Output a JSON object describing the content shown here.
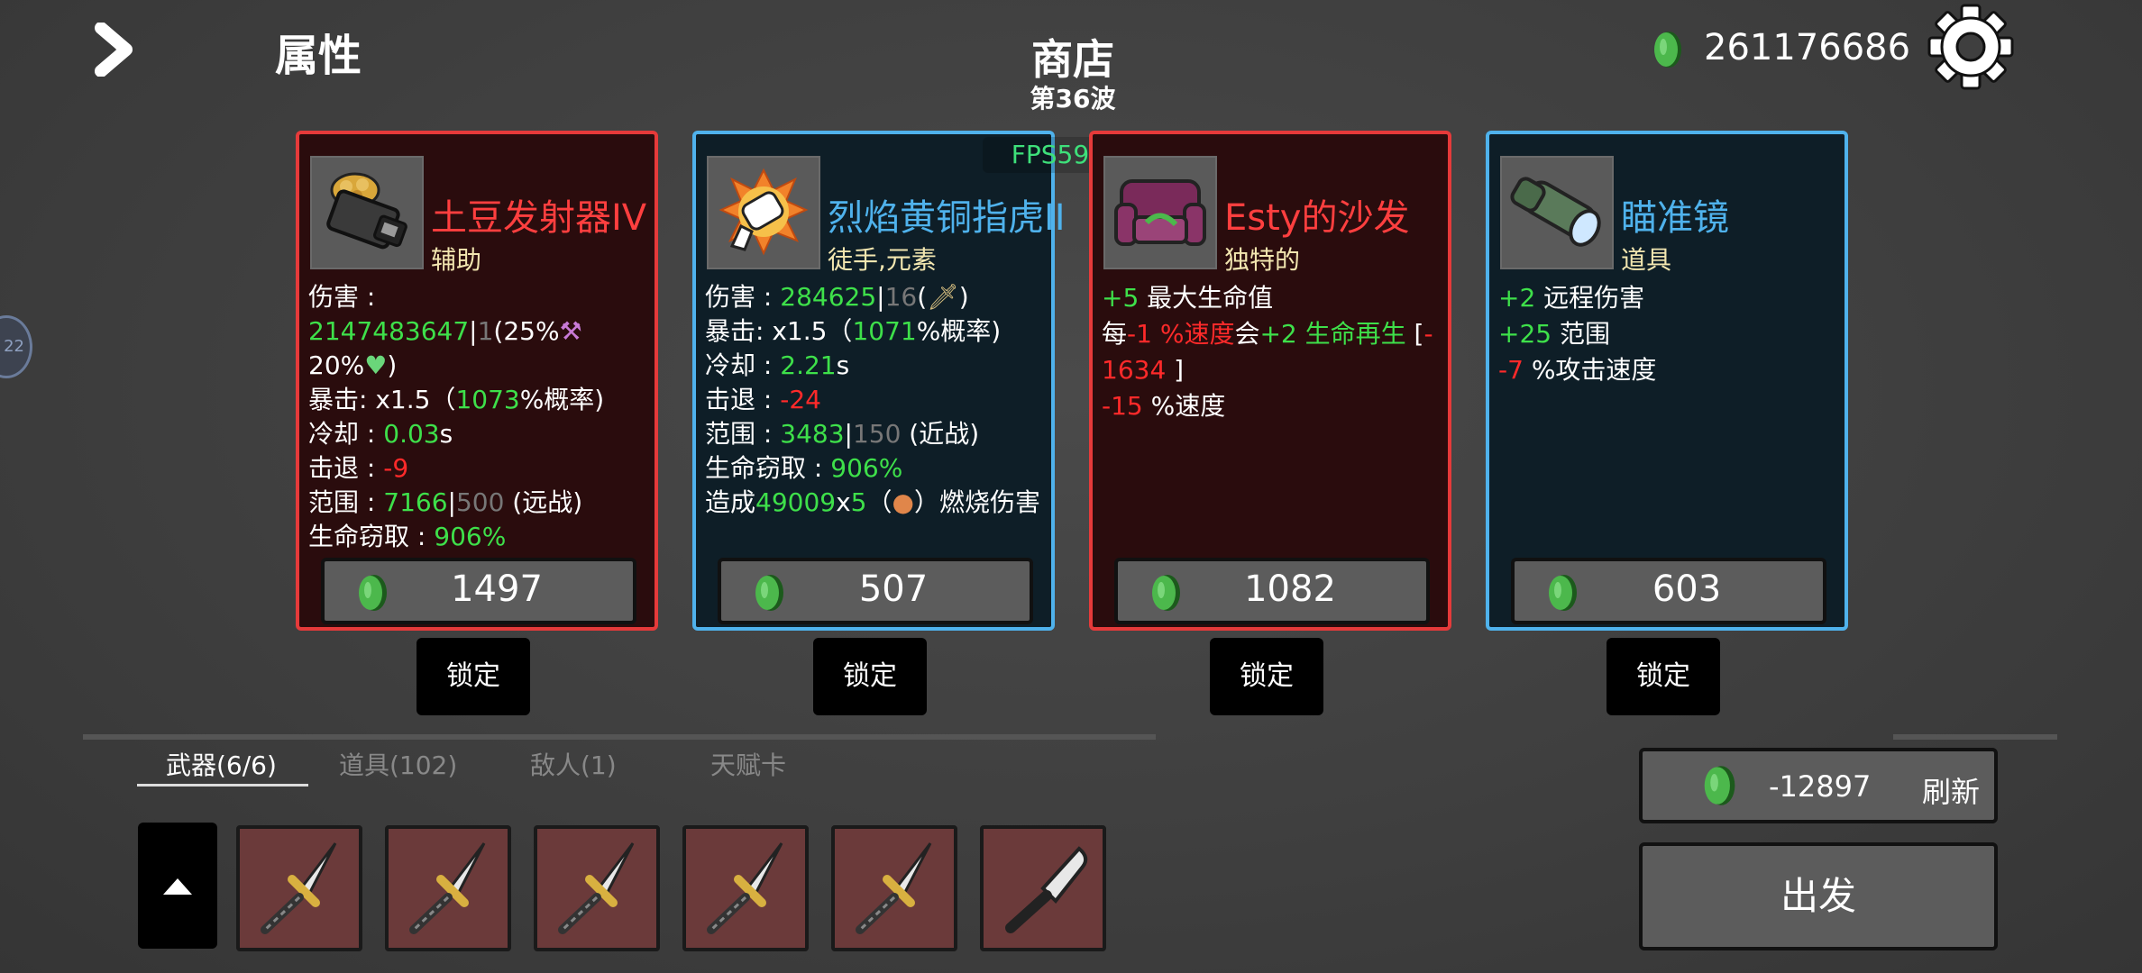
{
  "header": {
    "page_title": "属性",
    "shop_title": "商店",
    "wave": "第36波",
    "money": "261176686",
    "fps": "FPS59"
  },
  "side_bubble": "22",
  "cards": [
    {
      "name": "土豆发射器IV",
      "tag": "辅助",
      "price": "1497",
      "lock_label": "锁定"
    },
    {
      "name": "烈焰黄铜指虎II",
      "tag": "徒手,元素",
      "price": "507",
      "lock_label": "锁定"
    },
    {
      "name": "Esty的沙发",
      "tag": "独特的",
      "price": "1082",
      "lock_label": "锁定"
    },
    {
      "name": "瞄准镜",
      "tag": "道具",
      "price": "603",
      "lock_label": "锁定"
    }
  ],
  "card1_stats": {
    "damage_label": "伤害 : ",
    "damage": "2147483647",
    "damage_base": "1",
    "damage_bonus": "(25%",
    "damage_bonus2": "20%",
    "damage_close": ")",
    "crit_label": "暴击:  x1.5（",
    "crit_rate": "1073",
    "crit_end": "%概率)",
    "cooldown_label": "冷却 : ",
    "cooldown": "0.03",
    "cooldown_unit": "s",
    "knockback_label": "击退 : ",
    "knockback": "-9",
    "range_label": "范围 : ",
    "range": "7166",
    "range_base": "500",
    "range_type": " (远战)",
    "lifesteal_label": "生命窃取 : ",
    "lifesteal": "906%"
  },
  "card2_stats": {
    "damage_label": "伤害 : ",
    "damage": "284625",
    "damage_base": "16",
    "damage_open": "(",
    "damage_close": ")",
    "crit_label": "暴击:  x1.5（",
    "crit_rate": "1071",
    "crit_end": "%概率)",
    "cooldown_label": "冷却 : ",
    "cooldown": "2.21",
    "cooldown_unit": "s",
    "knockback_label": "击退 : ",
    "knockback": "-24",
    "range_label": "范围 : ",
    "range": "3483",
    "range_base": "150",
    "range_type": " (近战)",
    "lifesteal_label": "生命窃取 : ",
    "lifesteal": "906%",
    "burn_prefix": "造成",
    "burn_dmg": "49009",
    "burn_x": "x",
    "burn_times": "5",
    "burn_open": "（",
    "burn_suffix": "）燃烧伤害"
  },
  "card3_stats": {
    "l1_val": "+5",
    "l1_text": " 最大生命值",
    "l2_prefix": "每",
    "l2_speed": "-1 %速度",
    "l2_mid": "会",
    "l2_regen": "+2 生命再生",
    "l2_bracket": " [",
    "l2_val_a": "-",
    "l2_val_b": "1634",
    "l2_close": " ]",
    "l3_val": "-15",
    "l3_text": " %速度"
  },
  "card4_stats": {
    "l1_val": "+2",
    "l1_text": " 远程伤害",
    "l2_val": "+25",
    "l2_text": " 范围",
    "l3_val": "-7",
    "l3_text": " %攻击速度"
  },
  "tabs": [
    {
      "label": "武器(6/6)",
      "active": true
    },
    {
      "label": "道具(102)"
    },
    {
      "label": "敌人(1)"
    },
    {
      "label": "天赋卡"
    }
  ],
  "inventory": [
    "dagger-icon",
    "dagger-icon",
    "dagger-icon",
    "dagger-icon",
    "dagger-icon",
    "cleaver-icon"
  ],
  "refresh": {
    "cost": "-12897",
    "label": "刷新"
  },
  "go_label": "出发",
  "colors": {
    "accent_green": "#3ee04a",
    "accent_red": "#ff2a2a",
    "rare_border": "#e63a3a",
    "uncommon_border": "#4fb2ec"
  }
}
